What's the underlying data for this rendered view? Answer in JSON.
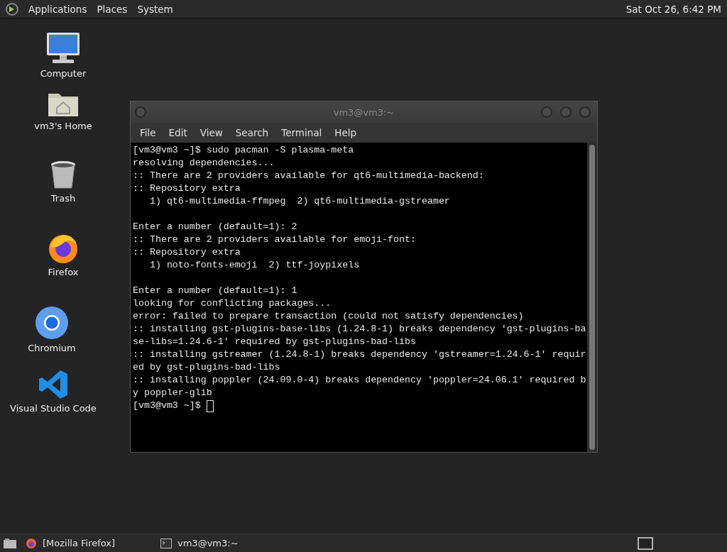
{
  "top_panel": {
    "menus": [
      "Applications",
      "Places",
      "System"
    ],
    "clock": "Sat Oct 26, 6:42 PM"
  },
  "desktop_icons": [
    {
      "kind": "computer",
      "label": "Computer"
    },
    {
      "kind": "home",
      "label": "vm3's Home"
    },
    {
      "kind": "trash",
      "label": "Trash"
    },
    {
      "kind": "firefox",
      "label": "Firefox"
    },
    {
      "kind": "chromium",
      "label": "Chromium"
    },
    {
      "kind": "vscode",
      "label": "Visual Studio Code"
    }
  ],
  "window": {
    "title": "vm3@vm3:~",
    "menu": [
      "File",
      "Edit",
      "View",
      "Search",
      "Terminal",
      "Help"
    ],
    "terminal": {
      "blocks": [
        [
          "[vm3@vm3 ~]$ sudo pacman -S plasma-meta",
          "resolving dependencies...",
          ":: There are 2 providers available for qt6-multimedia-backend:",
          ":: Repository extra",
          "   1) qt6-multimedia-ffmpeg  2) qt6-multimedia-gstreamer"
        ],
        [
          "Enter a number (default=1): 2",
          ":: There are 2 providers available for emoji-font:",
          ":: Repository extra",
          "   1) noto-fonts-emoji  2) ttf-joypixels"
        ],
        [
          "Enter a number (default=1): 1",
          "looking for conflicting packages...",
          "error: failed to prepare transaction (could not satisfy dependencies)",
          ":: installing gst-plugins-base-libs (1.24.8-1) breaks dependency 'gst-plugins-ba",
          "se-libs=1.24.6-1' required by gst-plugins-bad-libs",
          ":: installing gstreamer (1.24.8-1) breaks dependency 'gstreamer=1.24.6-1' requir",
          "ed by gst-plugins-bad-libs",
          ":: installing poppler (24.09.0-4) breaks dependency 'poppler=24.06.1' required b",
          "y poppler-glib"
        ]
      ],
      "prompt": "[vm3@vm3 ~]$"
    }
  },
  "taskbar": {
    "tasks": [
      {
        "kind": "firefox",
        "label": "[Mozilla Firefox]",
        "selected": false
      },
      {
        "kind": "terminal",
        "label": "vm3@vm3:~",
        "selected": false
      }
    ]
  }
}
